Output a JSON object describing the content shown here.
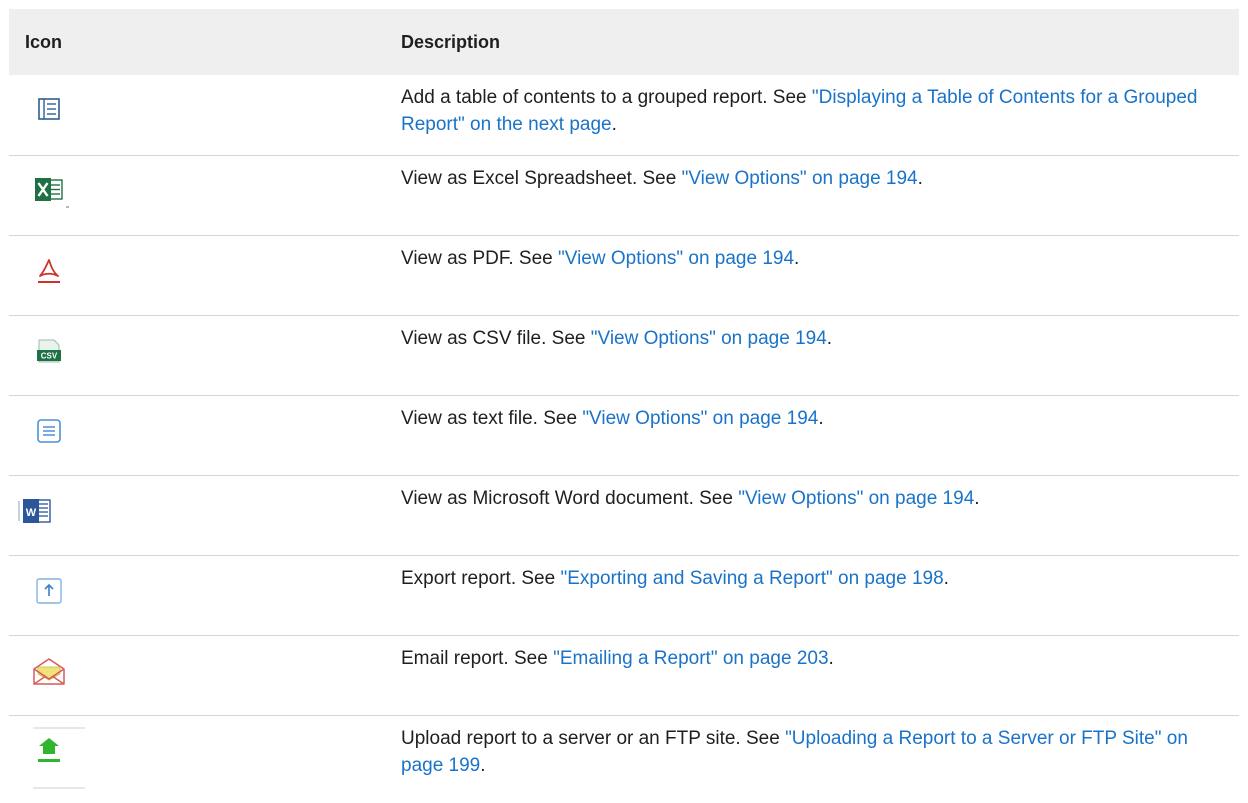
{
  "table": {
    "headers": {
      "icon": "Icon",
      "description": "Description"
    },
    "rows": [
      {
        "icon": "table-of-contents-icon",
        "text": "Add a table of contents to a grouped report. See ",
        "link": "\"Displaying a Table of Contents for a Grouped Report\" on the next page",
        "end": "."
      },
      {
        "icon": "excel-icon",
        "text": "View as Excel Spreadsheet. See ",
        "link": "\"View Options\" on page 194",
        "end": "."
      },
      {
        "icon": "pdf-icon",
        "text": "View as PDF. See ",
        "link": "\"View Options\" on page 194",
        "end": "."
      },
      {
        "icon": "csv-icon",
        "icon_text": "CSV",
        "text": "View as CSV file. See ",
        "link": "\"View Options\" on page 194",
        "end": "."
      },
      {
        "icon": "text-file-icon",
        "text": "View as text file. See ",
        "link": "\"View Options\" on page 194",
        "end": "."
      },
      {
        "icon": "word-icon",
        "icon_text": "W",
        "text": "View as Microsoft Word document. See ",
        "link": "\"View Options\" on page 194",
        "end": "."
      },
      {
        "icon": "export-icon",
        "text": "Export report. See ",
        "link": "\"Exporting and Saving a Report\" on page 198",
        "end": "."
      },
      {
        "icon": "email-icon",
        "text": "Email report. See ",
        "link": "\"Emailing a Report\" on page 203",
        "end": "."
      },
      {
        "icon": "upload-icon",
        "text": "Upload report to a server or an FTP site. See ",
        "link": "\"Uploading a Report to a Server or FTP Site\" on page 199",
        "end": "."
      }
    ]
  },
  "colors": {
    "link": "#1a73c8",
    "header_bg": "#efefef",
    "excel": "#1e7145",
    "word": "#2b579a",
    "pdf": "#d0312d",
    "upload": "#2fb52f"
  }
}
